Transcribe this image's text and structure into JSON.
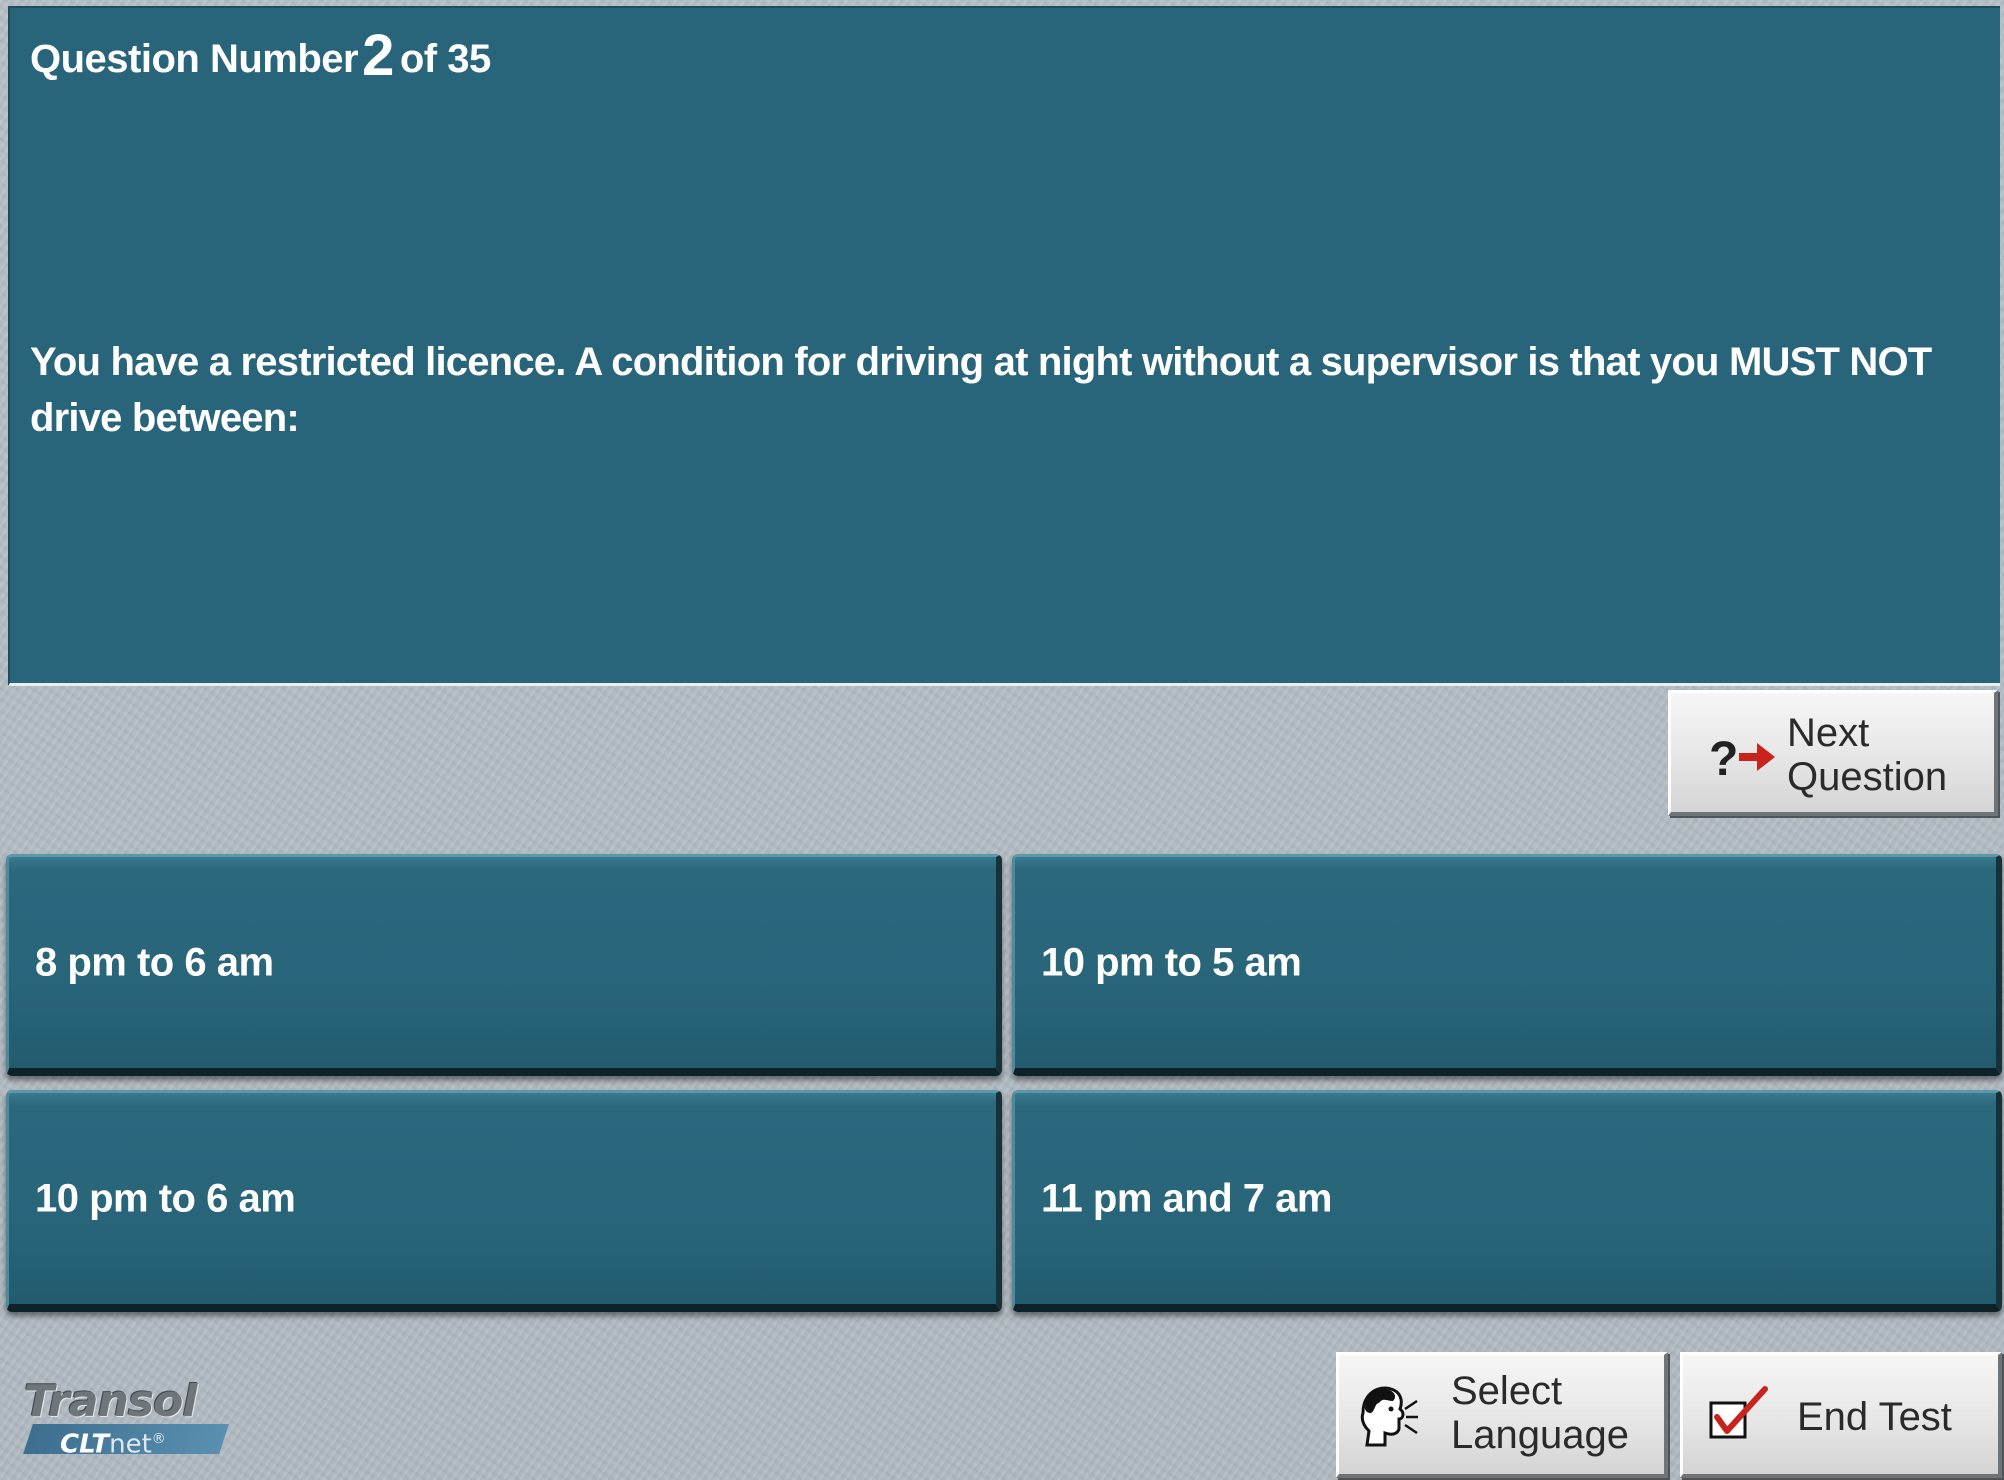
{
  "question_header": {
    "prefix": "Question Number",
    "current": "2",
    "suffix": "of 35"
  },
  "question": {
    "text": "You have a restricted licence. A condition for driving at night without a supervisor is that you MUST NOT drive between:"
  },
  "answers": [
    {
      "label": "8 pm to 6 am"
    },
    {
      "label": "10 pm to 5 am"
    },
    {
      "label": "10 pm to 6 am"
    },
    {
      "label": "11 pm and 7 am"
    }
  ],
  "buttons": {
    "next": {
      "line1": "Next",
      "line2": "Question",
      "icon": "question-arrow-icon"
    },
    "language": {
      "line1": "Select",
      "line2": "Language",
      "icon": "speaking-head-icon"
    },
    "end": {
      "label": "End Test",
      "icon": "checkbox-tick-icon"
    }
  },
  "logo": {
    "brand": "Transol",
    "sub_bold": "CLT",
    "sub_rest": "net",
    "mark": "®"
  },
  "colors": {
    "panel": "#29657a",
    "background": "#b4bec4",
    "accent_red": "#c8231d"
  }
}
